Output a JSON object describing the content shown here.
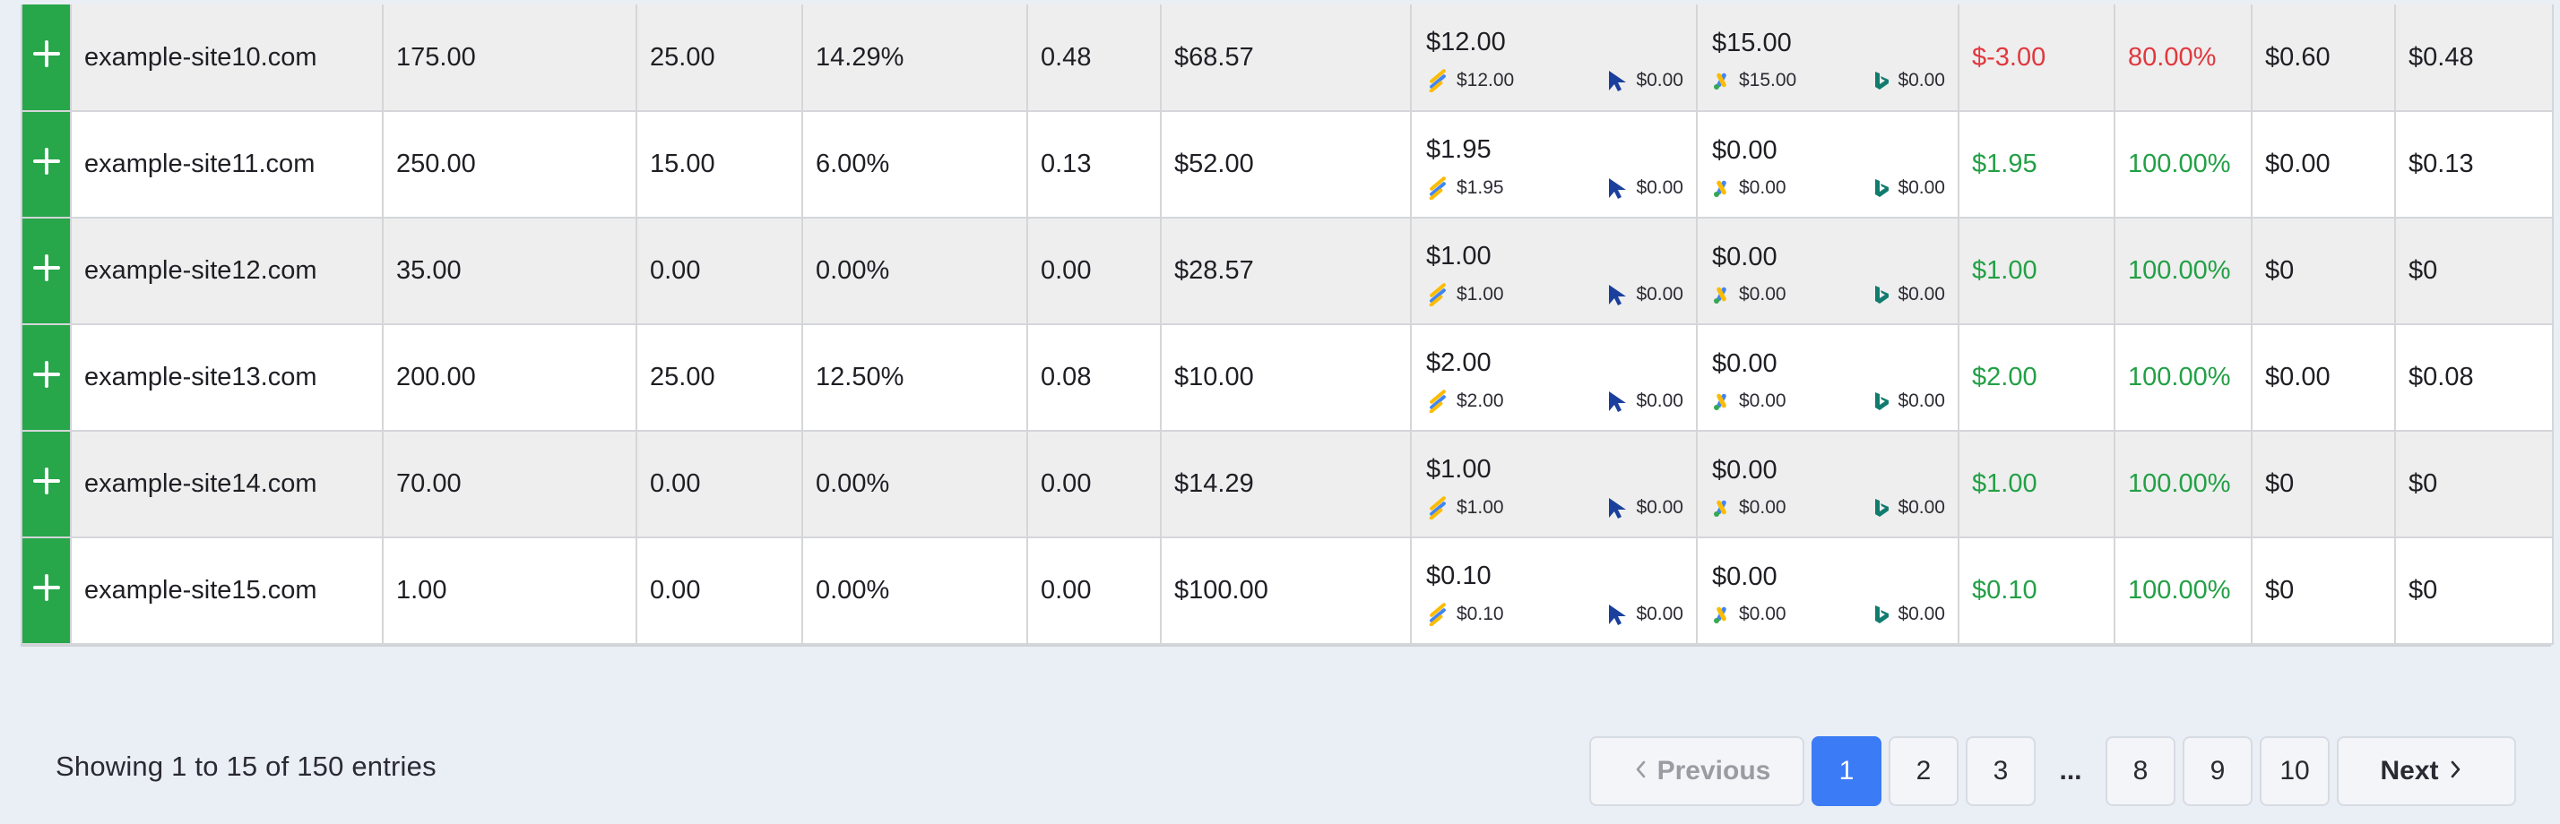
{
  "table": {
    "rows": [
      {
        "site": "example-site10.com",
        "c1": "175.00",
        "c2": "25.00",
        "c3": "14.29%",
        "c4": "0.48",
        "c5": "$68.57",
        "spend_a": {
          "total": "$12.00",
          "google": "$12.00",
          "pointer": "$0.00"
        },
        "spend_b": {
          "total": "$15.00",
          "ads": "$15.00",
          "bing": "$0.00"
        },
        "profit": "$-3.00",
        "roi": "80.00%",
        "c6": "$0.60",
        "c7": "$0.48",
        "status": "negative"
      },
      {
        "site": "example-site11.com",
        "c1": "250.00",
        "c2": "15.00",
        "c3": "6.00%",
        "c4": "0.13",
        "c5": "$52.00",
        "spend_a": {
          "total": "$1.95",
          "google": "$1.95",
          "pointer": "$0.00"
        },
        "spend_b": {
          "total": "$0.00",
          "ads": "$0.00",
          "bing": "$0.00"
        },
        "profit": "$1.95",
        "roi": "100.00%",
        "c6": "$0.00",
        "c7": "$0.13",
        "status": "positive"
      },
      {
        "site": "example-site12.com",
        "c1": "35.00",
        "c2": "0.00",
        "c3": "0.00%",
        "c4": "0.00",
        "c5": "$28.57",
        "spend_a": {
          "total": "$1.00",
          "google": "$1.00",
          "pointer": "$0.00"
        },
        "spend_b": {
          "total": "$0.00",
          "ads": "$0.00",
          "bing": "$0.00"
        },
        "profit": "$1.00",
        "roi": "100.00%",
        "c6": "$0",
        "c7": "$0",
        "status": "positive"
      },
      {
        "site": "example-site13.com",
        "c1": "200.00",
        "c2": "25.00",
        "c3": "12.50%",
        "c4": "0.08",
        "c5": "$10.00",
        "spend_a": {
          "total": "$2.00",
          "google": "$2.00",
          "pointer": "$0.00"
        },
        "spend_b": {
          "total": "$0.00",
          "ads": "$0.00",
          "bing": "$0.00"
        },
        "profit": "$2.00",
        "roi": "100.00%",
        "c6": "$0.00",
        "c7": "$0.08",
        "status": "positive"
      },
      {
        "site": "example-site14.com",
        "c1": "70.00",
        "c2": "0.00",
        "c3": "0.00%",
        "c4": "0.00",
        "c5": "$14.29",
        "spend_a": {
          "total": "$1.00",
          "google": "$1.00",
          "pointer": "$0.00"
        },
        "spend_b": {
          "total": "$0.00",
          "ads": "$0.00",
          "bing": "$0.00"
        },
        "profit": "$1.00",
        "roi": "100.00%",
        "c6": "$0",
        "c7": "$0",
        "status": "positive"
      },
      {
        "site": "example-site15.com",
        "c1": "1.00",
        "c2": "0.00",
        "c3": "0.00%",
        "c4": "0.00",
        "c5": "$100.00",
        "spend_a": {
          "total": "$0.10",
          "google": "$0.10",
          "pointer": "$0.00"
        },
        "spend_b": {
          "total": "$0.00",
          "ads": "$0.00",
          "bing": "$0.00"
        },
        "profit": "$0.10",
        "roi": "100.00%",
        "c6": "$0",
        "c7": "$0",
        "status": "positive"
      }
    ]
  },
  "footer": {
    "info": "Showing 1 to 15 of 150 entries"
  },
  "pagination": {
    "previous": "Previous",
    "next": "Next",
    "ellipsis": "...",
    "pages": [
      "1",
      "2",
      "3",
      "8",
      "9",
      "10"
    ],
    "active": "1"
  },
  "colors": {
    "expand_button": "#27a64a",
    "negative": "#e0383e",
    "positive": "#23a046",
    "active_page": "#3b7bf6"
  },
  "icons": {
    "expand": "plus-icon",
    "spend_a_1": "google-ads-stripes-icon",
    "spend_a_2": "pointer-arrow-icon",
    "spend_b_1": "google-ads-icon",
    "spend_b_2": "bing-icon",
    "prev": "chevron-left-icon",
    "next": "chevron-right-icon"
  }
}
